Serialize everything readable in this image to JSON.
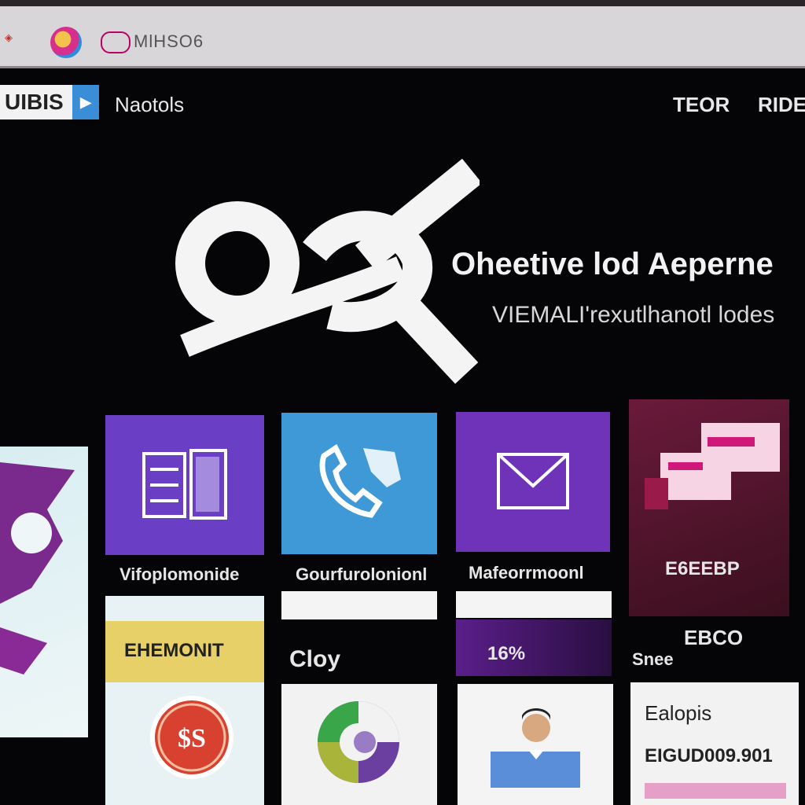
{
  "browser": {
    "tab_title": "MlHSO6"
  },
  "nav": {
    "brand": "UIBIS",
    "left_link": "Naotols",
    "right_links": [
      "TEOR",
      "RIDE"
    ]
  },
  "hero": {
    "title": "Oheetive lod Aeperne",
    "subtitle": "VIEMALI'rexutlhanotl lodes"
  },
  "tiles": [
    {
      "label": "Vifoplomonide",
      "icon": "file-icon",
      "color": "#6a3fc6"
    },
    {
      "label": "Gourfurolonionl",
      "icon": "phone-icon",
      "color": "#3f99d6"
    },
    {
      "label": "Mafeorrmoonl",
      "icon": "mail-icon",
      "color": "#6e33b8"
    },
    {
      "label": "E6EEBP",
      "icon": "chat-icon",
      "color": "#b0126a"
    }
  ],
  "row2": {
    "banner": "EHEMONIT",
    "clop": "Cloy",
    "video_label": "16%",
    "store_label": "Snee",
    "ebco": "EBCO"
  },
  "row3": {
    "ealop": "Ealopis",
    "numbers": "EIGUD009.901"
  },
  "colors": {
    "accent_purple": "#6a3fc6",
    "accent_blue": "#3f99d6",
    "accent_pink": "#d0187a"
  }
}
